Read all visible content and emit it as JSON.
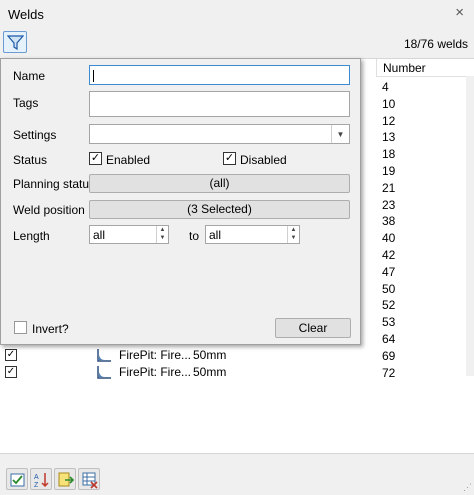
{
  "window": {
    "title": "Welds",
    "close_glyph": "×"
  },
  "toolbar": {
    "filter_icon": "filter-icon",
    "count": "18/76 welds"
  },
  "table": {
    "number_header": "Number",
    "numbers": [
      "4",
      "10",
      "12",
      "13",
      "18",
      "19",
      "21",
      "23",
      "38",
      "40",
      "42",
      "47",
      "50",
      "52",
      "53",
      "64",
      "69",
      "72"
    ],
    "visible_rows": [
      {
        "checked": true,
        "name": "FirePit: Fire...",
        "length": "50mm"
      },
      {
        "checked": true,
        "name": "FirePit: Fire...",
        "length": "50mm"
      }
    ]
  },
  "filter_popup": {
    "name_label": "Name",
    "name_value": "",
    "tags_label": "Tags",
    "tags_value": "",
    "settings_label": "Settings",
    "settings_value": "",
    "status_label": "Status",
    "status_enabled_label": "Enabled",
    "status_enabled_checked": true,
    "status_disabled_label": "Disabled",
    "status_disabled_checked": true,
    "planning_label": "Planning status",
    "planning_value": "(all)",
    "position_label": "Weld position",
    "position_value": "(3 Selected)",
    "length_label": "Length",
    "length_from": "all",
    "length_to_label": "to",
    "length_to": "all",
    "invert_label": "Invert?",
    "invert_checked": false,
    "clear_label": "Clear"
  },
  "bottom_toolbar": {
    "icons": [
      "select-all-icon",
      "sort-icon",
      "export-icon",
      "settings-grid-icon"
    ]
  },
  "colors": {
    "accent": "#3c8ad0",
    "panel_bg": "#f0f0f0"
  }
}
